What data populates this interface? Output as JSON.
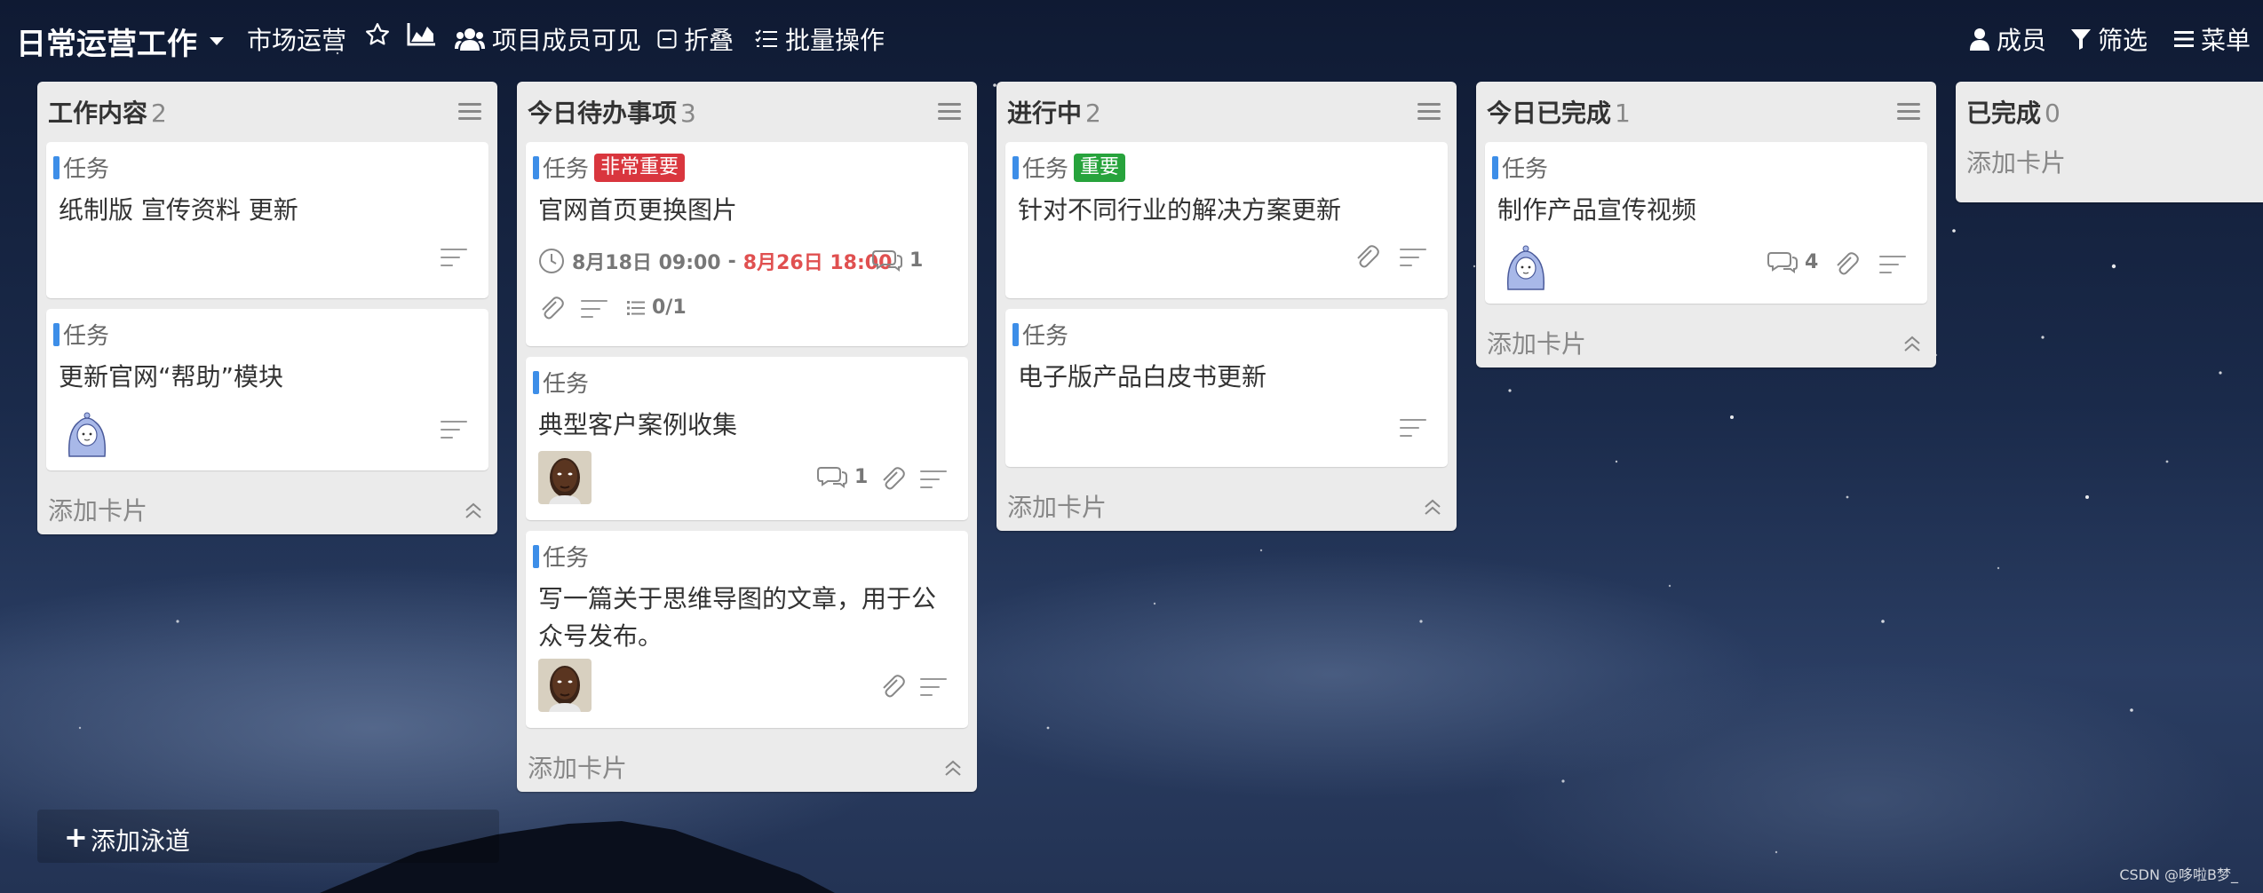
{
  "topbar": {
    "board_title": "日常运营工作",
    "project_name": "市场运营",
    "visibility": "项目成员可见",
    "collapse": "折叠",
    "batch": "批量操作",
    "members": "成员",
    "filter": "筛选",
    "menu": "菜单"
  },
  "icons": {
    "star": "star-icon",
    "chart": "chart-icon",
    "members": "users-icon",
    "collapse": "minus-square-icon",
    "batch": "checklist-icon",
    "member": "user-icon",
    "filter": "funnel-icon",
    "menu": "hamburger-icon"
  },
  "colors": {
    "type_bar": "#3d8ee8",
    "tag_red": "#d9363e",
    "tag_green": "#27a33c",
    "overdue": "#e05050"
  },
  "lists": [
    {
      "title": "工作内容",
      "count": "2",
      "add_card": "添加卡片",
      "cards": [
        {
          "type": "任务",
          "title": "纸制版 宣传资料 更新"
        },
        {
          "type": "任务",
          "title": "更新官网“帮助”模块"
        }
      ]
    },
    {
      "title": "今日待办事项",
      "count": "3",
      "add_card": "添加卡片",
      "cards": [
        {
          "type": "任务",
          "tag": "非常重要",
          "title": "官网首页更换图片",
          "start": "8月18日 09:00",
          "separator": "-",
          "due": "8月26日 18:00",
          "comments": "1",
          "checklist": "0/1"
        },
        {
          "type": "任务",
          "title": "典型客户案例收集",
          "comments": "1"
        },
        {
          "type": "任务",
          "title": "写一篇关于思维导图的文章，用于公众号发布。"
        }
      ]
    },
    {
      "title": "进行中",
      "count": "2",
      "add_card": "添加卡片",
      "cards": [
        {
          "type": "任务",
          "tag": "重要",
          "title": "针对不同行业的解决方案更新"
        },
        {
          "type": "任务",
          "title": "电子版产品白皮书更新"
        }
      ]
    },
    {
      "title": "今日已完成",
      "count": "1",
      "add_card": "添加卡片",
      "cards": [
        {
          "type": "任务",
          "title": "制作产品宣传视频",
          "comments": "4"
        }
      ]
    },
    {
      "title": "已完成",
      "count": "0",
      "add_card": "添加卡片",
      "cards": []
    }
  ],
  "add_lane": "添加泳道",
  "watermark": "CSDN @哆啦B梦_"
}
